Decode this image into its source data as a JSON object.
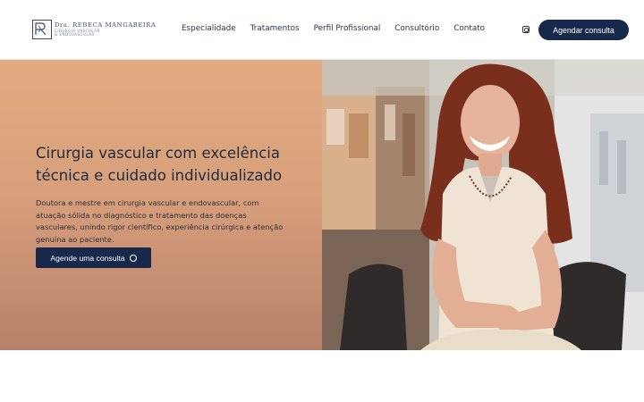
{
  "brand": {
    "name": "Dra. REBECA MANGABEIRA",
    "sub1": "CIRURGIA VASCULAR",
    "sub2": "& ENDOVASCULAR"
  },
  "nav": {
    "items": [
      {
        "label": "Especialidade"
      },
      {
        "label": "Tratamentos"
      },
      {
        "label": "Perfil Profissional"
      },
      {
        "label": "Consultório"
      },
      {
        "label": "Contato"
      }
    ]
  },
  "header": {
    "instagram_icon": "instagram-icon",
    "cta_label": "Agendar consulta"
  },
  "hero": {
    "title_line1": "Cirurgia vascular com excelência",
    "title_line2": "técnica e cuidado individualizado",
    "description": "Doutora e mestre em cirurgia vascular e endovascular, com atuação sólida no diagnóstico e tratamento das doenças vasculares, unindo rigor científico, experiência cirúrgica e atenção genuína ao paciente.",
    "cta_label": "Agende uma consulta",
    "cta_icon": "whatsapp-icon"
  },
  "colors": {
    "navy": "#17294a",
    "hero_bg_top": "#e2ab80",
    "hero_bg_bottom": "#b78068"
  }
}
